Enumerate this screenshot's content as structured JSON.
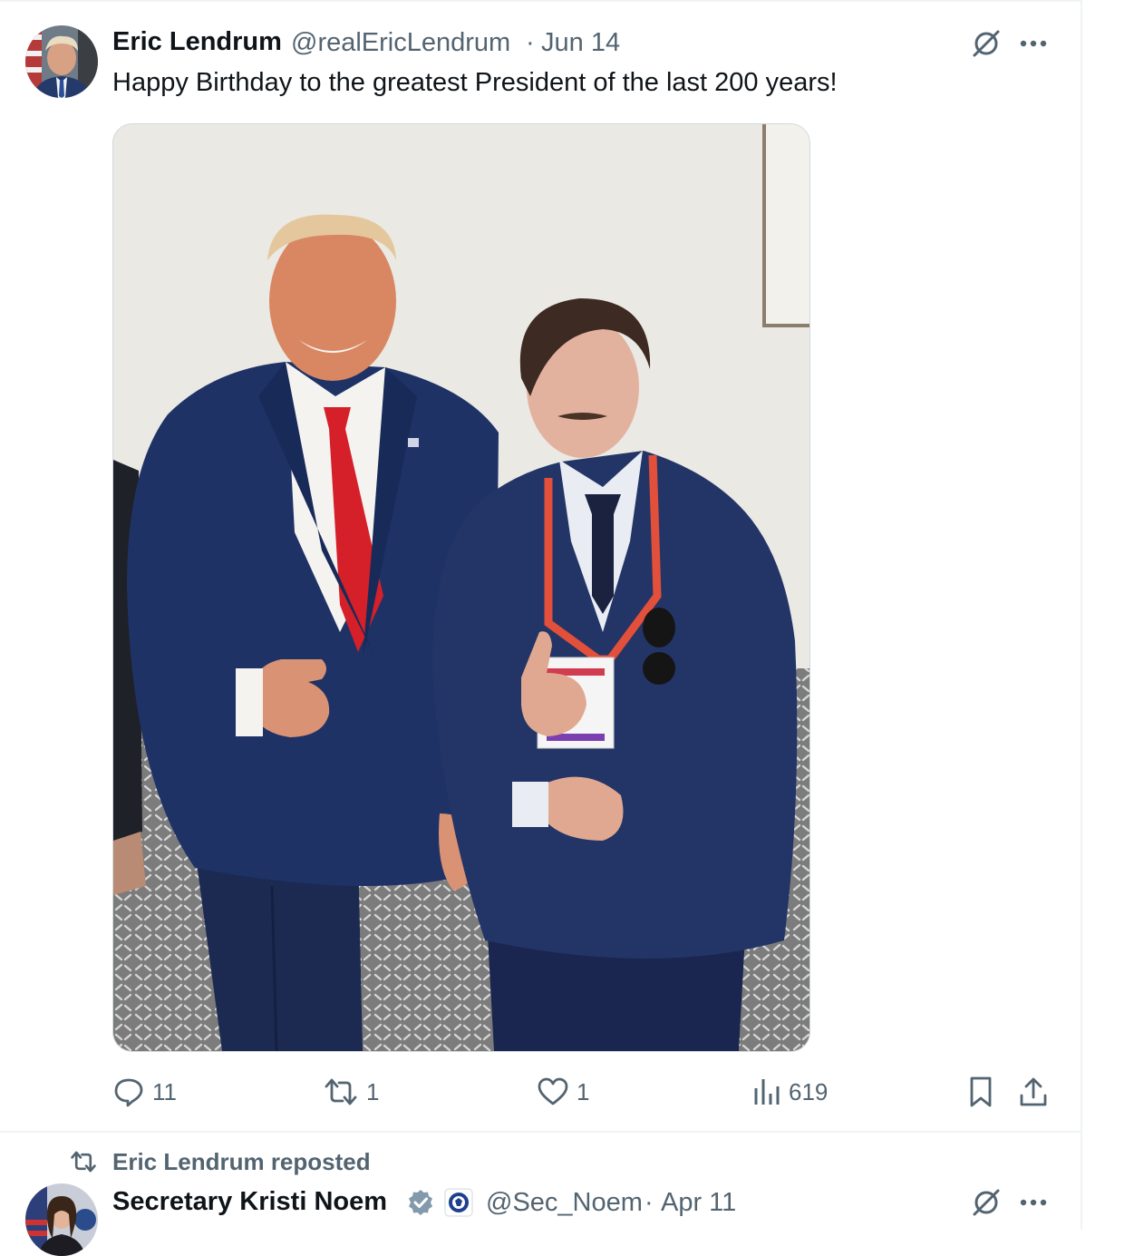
{
  "tweet": {
    "author_name": "Eric Lendrum",
    "handle": "@realEricLendrum",
    "separator": "·",
    "date": "Jun 14",
    "text": "Happy Birthday to the greatest President of the last 200 years!",
    "stats": {
      "replies": "11",
      "reposts": "1",
      "likes": "1",
      "views": "619"
    }
  },
  "next_tweet": {
    "repost_label": "Eric Lendrum reposted",
    "author_name": "Secretary Kristi Noem",
    "handle": "@Sec_Noem",
    "separator": "·",
    "date": "Apr 11"
  },
  "icons": [
    "grok-icon",
    "more-icon",
    "reply-icon",
    "repost-icon",
    "like-icon",
    "views-icon",
    "bookmark-icon",
    "share-icon",
    "verified-badge-icon",
    "dhs-seal-icon"
  ],
  "colors": {
    "text_primary": "#0f1419",
    "text_secondary": "#536471",
    "divider": "#eff3f4",
    "verified_gray": "#829aab"
  }
}
